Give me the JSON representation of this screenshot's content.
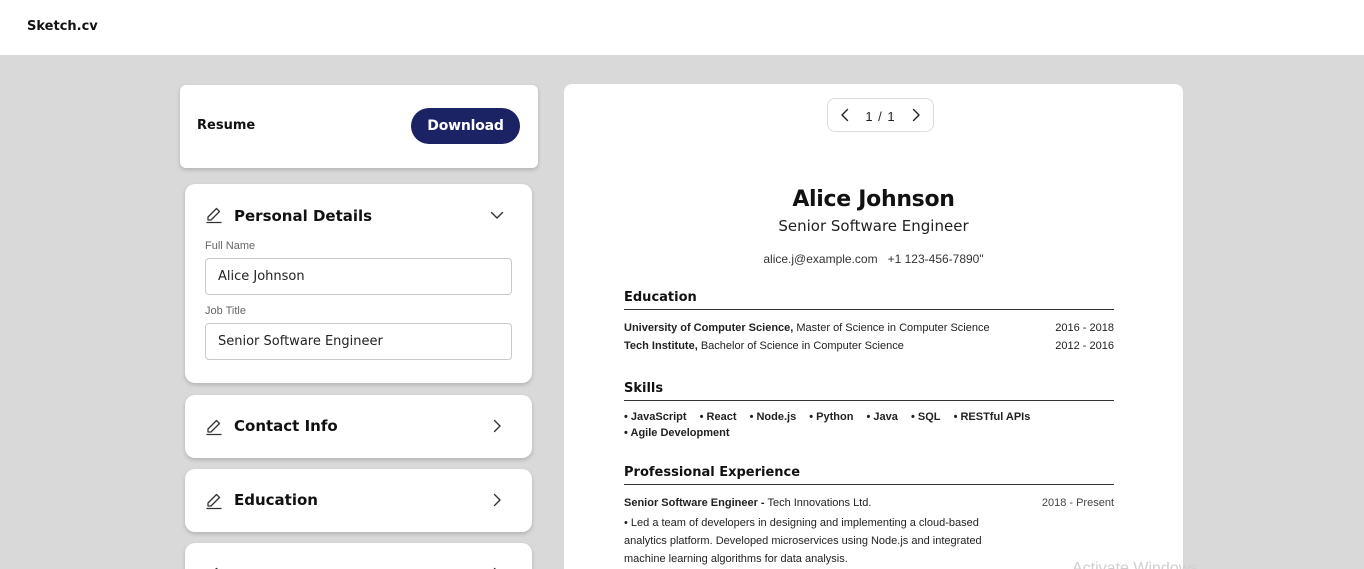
{
  "app": {
    "brand": "Sketch.cv"
  },
  "editor": {
    "resume_label": "Resume",
    "download_label": "Download",
    "sections": {
      "personal": {
        "title": "Personal Details",
        "fields": {
          "full_name_label": "Full Name",
          "full_name_value": "Alice Johnson",
          "job_title_label": "Job Title",
          "job_title_value": "Senior Software Engineer"
        }
      },
      "contact": {
        "title": "Contact Info"
      },
      "education": {
        "title": "Education"
      }
    }
  },
  "preview": {
    "pager": {
      "text": "1 / 1"
    },
    "name": "Alice Johnson",
    "title": "Senior Software Engineer",
    "email": "alice.j@example.com",
    "phone": "+1 123-456-7890\"",
    "education": {
      "heading": "Education",
      "items": [
        {
          "institution": "University of Computer Science,",
          "degree": "Master of Science in Computer Science",
          "dates": "2016 - 2018"
        },
        {
          "institution": "Tech Institute,",
          "degree": "Bachelor of Science in Computer Science",
          "dates": "2012 - 2016"
        }
      ]
    },
    "skills": {
      "heading": "Skills",
      "items": [
        "• JavaScript",
        "• React",
        "• Node.js",
        "• Python",
        "• Java",
        "• SQL",
        "• RESTful APIs",
        "• Agile Development"
      ]
    },
    "experience": {
      "heading": "Professional Experience",
      "items": [
        {
          "role": "Senior Software Engineer -",
          "company": "Tech Innovations Ltd.",
          "dates": "2018 - Present",
          "description": "• Led a team of developers in designing and implementing a cloud-based analytics platform. Developed microservices using Node.js and integrated machine learning algorithms for data analysis."
        }
      ]
    }
  },
  "overlay": {
    "watermark": "Activate Windows"
  }
}
